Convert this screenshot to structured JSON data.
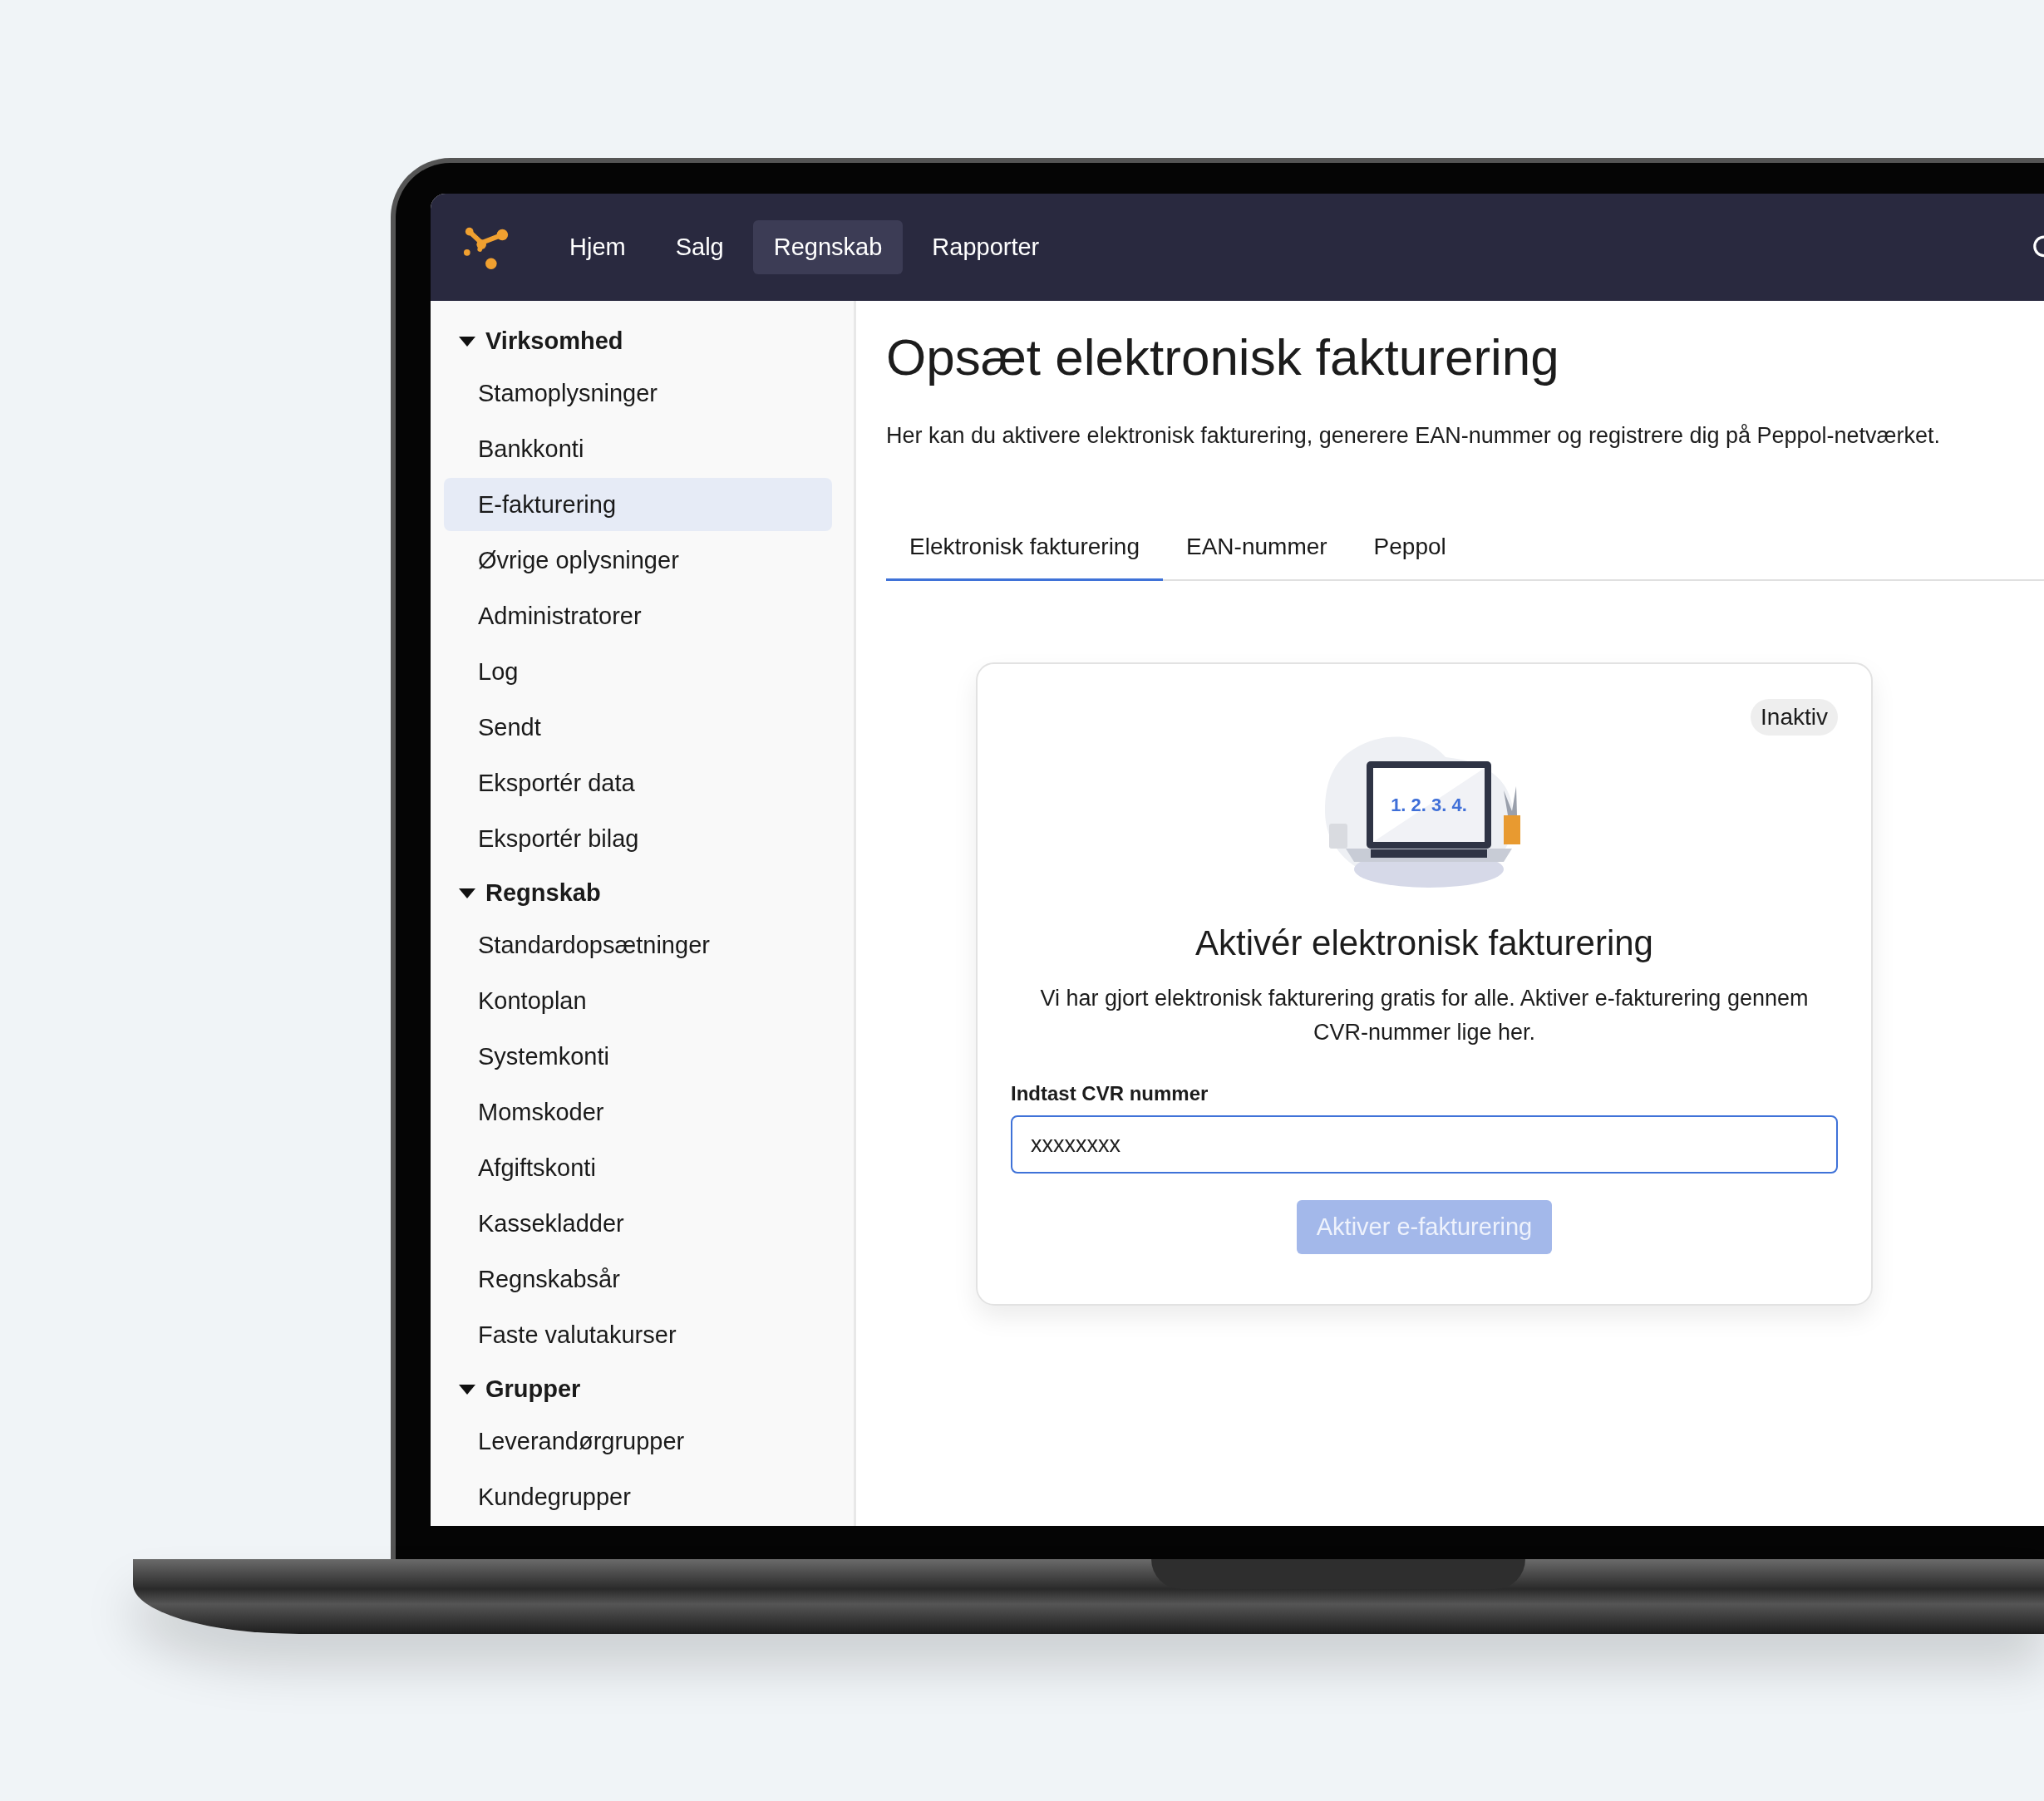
{
  "nav": {
    "items": [
      {
        "label": "Hjem",
        "selected": false
      },
      {
        "label": "Salg",
        "selected": false
      },
      {
        "label": "Regnskab",
        "selected": true
      },
      {
        "label": "Rapporter",
        "selected": false
      }
    ]
  },
  "sidebar": {
    "groups": [
      {
        "label": "Virksomhed",
        "expanded": true,
        "children": [
          {
            "label": "Stamoplysninger",
            "selected": false
          },
          {
            "label": "Bankkonti",
            "selected": false
          },
          {
            "label": "E-fakturering",
            "selected": true
          },
          {
            "label": "Øvrige oplysninger",
            "selected": false
          },
          {
            "label": "Administratorer",
            "selected": false
          },
          {
            "label": "Log",
            "selected": false
          },
          {
            "label": "Sendt",
            "selected": false
          },
          {
            "label": "Eksportér data",
            "selected": false
          },
          {
            "label": "Eksportér bilag",
            "selected": false
          }
        ]
      },
      {
        "label": "Regnskab",
        "expanded": true,
        "children": [
          {
            "label": "Standardopsætninger",
            "selected": false
          },
          {
            "label": "Kontoplan",
            "selected": false
          },
          {
            "label": "Systemkonti",
            "selected": false
          },
          {
            "label": "Momskoder",
            "selected": false
          },
          {
            "label": "Afgiftskonti",
            "selected": false
          },
          {
            "label": "Kassekladder",
            "selected": false
          },
          {
            "label": "Regnskabsår",
            "selected": false
          },
          {
            "label": "Faste valutakurser",
            "selected": false
          }
        ]
      },
      {
        "label": "Grupper",
        "expanded": true,
        "children": [
          {
            "label": "Leverandørgrupper",
            "selected": false
          },
          {
            "label": "Kundegrupper",
            "selected": false
          }
        ]
      }
    ]
  },
  "page": {
    "title": "Opsæt elektronisk fakturering",
    "description": "Her kan du aktivere elektronisk fakturering, generere EAN-nummer og registrere dig på Peppol-netværket."
  },
  "tabs": [
    {
      "label": "Elektronisk fakturering",
      "selected": true
    },
    {
      "label": "EAN-nummer",
      "selected": false
    },
    {
      "label": "Peppol",
      "selected": false
    }
  ],
  "card": {
    "status": "Inaktiv",
    "illustration_text": "1. 2. 3. 4.",
    "heading": "Aktivér elektronisk fakturering",
    "text": "Vi har gjort elektronisk fakturering gratis for alle. Aktiver e-fakturering gennem CVR-nummer lige her.",
    "field_label": "Indtast CVR nummer",
    "field_value": "xxxxxxxx",
    "button": {
      "label": "Aktiver e-fakturering",
      "disabled": true
    }
  }
}
